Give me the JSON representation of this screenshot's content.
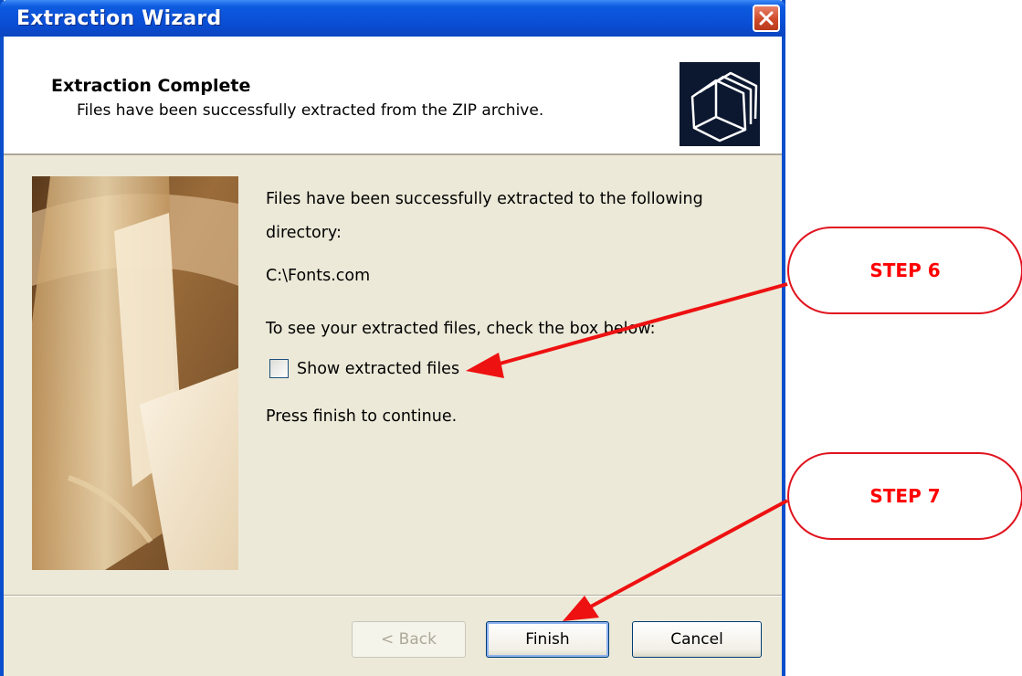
{
  "window": {
    "title": "Extraction Wizard",
    "close_icon": "close-icon"
  },
  "header": {
    "title": "Extraction Complete",
    "subtitle": "Files have been successfully extracted from the ZIP archive.",
    "icon": "folders-icon"
  },
  "body": {
    "image": "folder-photo",
    "line1": "Files have been successfully extracted to the following",
    "line2": "directory:",
    "directory": "C:\\Fonts.com",
    "check_prompt": "To see your extracted files, check the box below:",
    "checkbox_label": "Show extracted files",
    "checkbox_checked": false,
    "finish_prompt": "Press finish to continue."
  },
  "buttons": {
    "back": "< Back",
    "finish": "Finish",
    "cancel": "Cancel"
  },
  "annotations": {
    "step6": "STEP 6",
    "step7": "STEP 7",
    "color": "#ff0000"
  }
}
